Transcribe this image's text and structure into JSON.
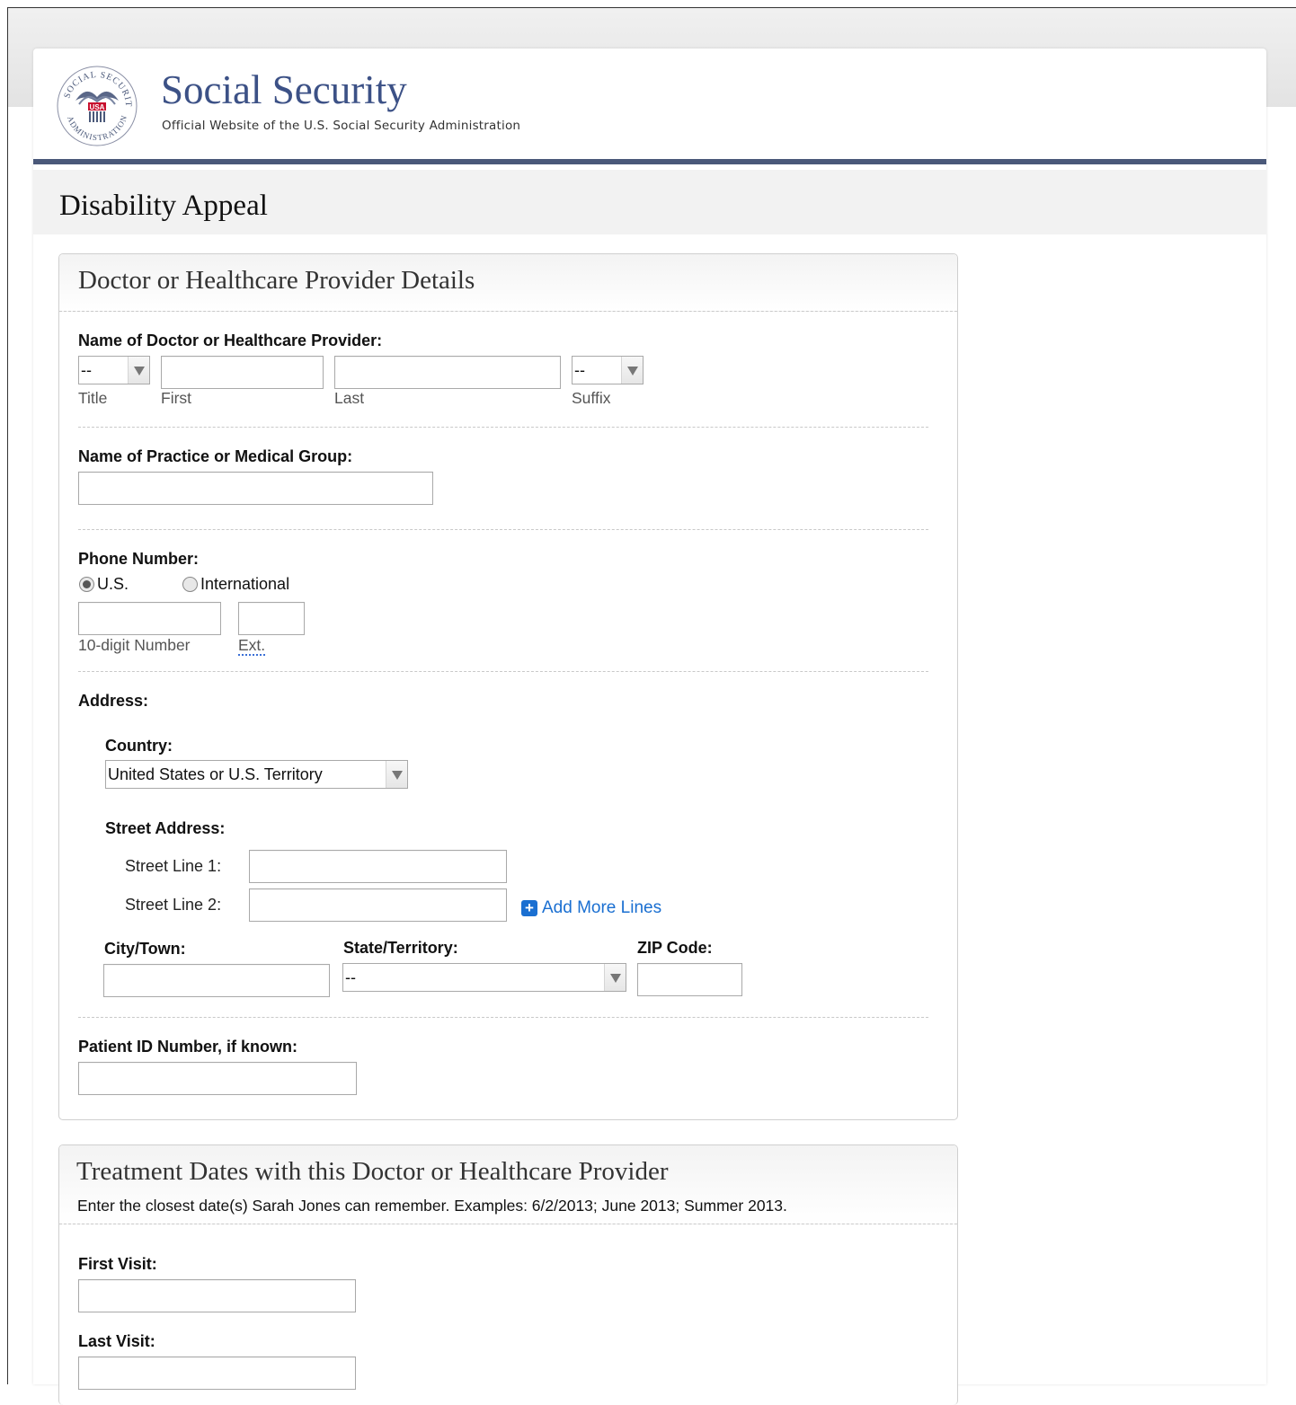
{
  "brand": {
    "title": "Social Security",
    "subtitle": "Official Website of the U.S. Social Security Administration",
    "seal_text_top": "SOCIAL SECURITY",
    "seal_text_bottom": "ADMINISTRATION",
    "seal_center": "USA"
  },
  "page_title": "Disability Appeal",
  "provider_panel": {
    "title": "Doctor or Healthcare Provider Details",
    "name_label": "Name of Doctor or Healthcare Provider:",
    "title_select_value": "--",
    "suffix_select_value": "--",
    "sub_labels": {
      "title": "Title",
      "first": "First",
      "last": "Last",
      "suffix": "Suffix"
    },
    "practice_label": "Name of Practice or Medical Group:",
    "phone_label": "Phone Number:",
    "phone_radio_us": "U.S.",
    "phone_radio_intl": "International",
    "phone_number_hint": "10-digit Number",
    "phone_ext_hint": "Ext.",
    "address_label": "Address:",
    "country_label": "Country:",
    "country_value": "United States or U.S. Territory",
    "street_label": "Street Address:",
    "street_line1": "Street Line 1:",
    "street_line2": "Street Line 2:",
    "add_more_lines": "Add More Lines",
    "city_label": "City/Town:",
    "state_label": "State/Territory:",
    "state_value": "--",
    "zip_label": "ZIP Code:",
    "patient_id_label": "Patient ID Number, if known:"
  },
  "treatment_panel": {
    "title": "Treatment Dates with this Doctor or Healthcare Provider",
    "description": "Enter the closest date(s) Sarah Jones can remember. Examples: 6/2/2013; June 2013; Summer 2013.",
    "first_visit_label": "First Visit:",
    "last_visit_label": "Last Visit:"
  },
  "colors": {
    "brand_blue": "#3c5186",
    "header_rule": "#4a5879",
    "link_blue": "#1a6fd1"
  }
}
